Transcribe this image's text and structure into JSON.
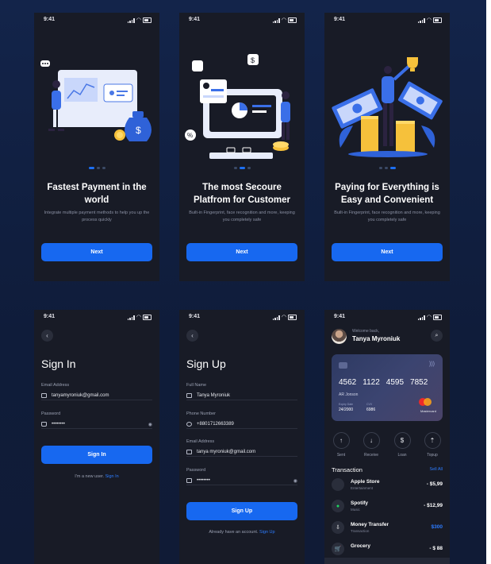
{
  "status": {
    "time": "9:41"
  },
  "onboarding": [
    {
      "title": "Fastest Payment in the world",
      "subtitle": "Integrate multiple payment methods to help you up the process quickly",
      "button": "Next"
    },
    {
      "title": "The most Secoure Platfrom for Customer",
      "subtitle": "Built-in Fingerprint, face recognition and more, keeping you completely safe",
      "button": "Next"
    },
    {
      "title": "Paying for Everything is Easy and Convenient",
      "subtitle": "Built-in Fingerprint, face recognition and more, keeping you completely safe",
      "button": "Next"
    }
  ],
  "signin": {
    "title": "Sign In",
    "email_label": "Email Address",
    "email_value": "tanyamyroniuk@gmail.com",
    "password_label": "Password",
    "password_value": "••••••••",
    "button": "Sign In",
    "footer_text": "I'm a new user.",
    "footer_link": "Sign In"
  },
  "signup": {
    "title": "Sign Up",
    "name_label": "Full Name",
    "name_value": "Tanya Myroniuk",
    "phone_label": "Phone Number",
    "phone_value": "+8801712663389",
    "email_label": "Email Address",
    "email_value": "tanya myroniuk@gmail.com",
    "password_label": "Password",
    "password_value": "••••••••",
    "button": "Sign Up",
    "footer_text": "Already have an account.",
    "footer_link": "Sign Up"
  },
  "home": {
    "welcome": "Welcome back,",
    "name": "Tanya Myroniuk",
    "card": {
      "number": [
        "4562",
        "1122",
        "4595",
        "7852"
      ],
      "holder": "AR Jonson",
      "expiry_label": "Expiry Date",
      "expiry": "24/2000",
      "cvv_label": "CVV",
      "cvv": "6986",
      "brand": "Mastercard"
    },
    "actions": [
      {
        "label": "Sent",
        "icon": "↑"
      },
      {
        "label": "Receive",
        "icon": "↓"
      },
      {
        "label": "Loan",
        "icon": "$"
      },
      {
        "label": "Topup",
        "icon": "⇡"
      }
    ],
    "transactions_title": "Transaction",
    "see_all": "Sell All",
    "transactions": [
      {
        "name": "Apple Store",
        "category": "Entertainment",
        "amount": "- $5,99",
        "icon": ""
      },
      {
        "name": "Spotify",
        "category": "Music",
        "amount": "- $12,99",
        "icon": "●"
      },
      {
        "name": "Money Transfer",
        "category": "Transaction",
        "amount": "$300",
        "icon": "⇩"
      },
      {
        "name": "Grocery",
        "category": "",
        "amount": "- $ 88",
        "icon": "🛒"
      }
    ]
  },
  "colors": {
    "accent": "#1768f0",
    "background": "#101d3c",
    "phone": "#181b26"
  }
}
